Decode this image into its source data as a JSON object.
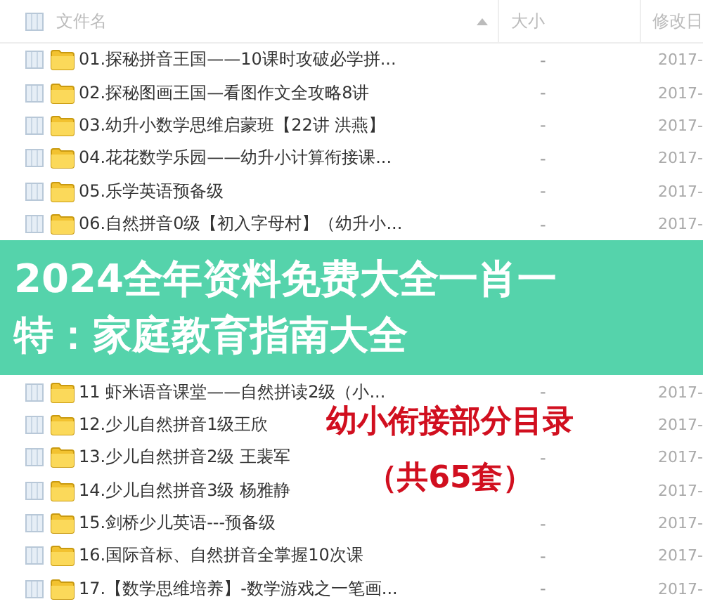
{
  "header": {
    "checked": false,
    "name": "文件名",
    "size": "大小",
    "date": "修改日"
  },
  "rows": [
    {
      "name": "01.探秘拼音王国——10课时攻破必学拼...",
      "size": "-",
      "date": "2017-",
      "checked": false
    },
    {
      "name": "02.探秘图画王国—看图作文全攻略8讲",
      "size": "-",
      "date": "2017-",
      "checked": false
    },
    {
      "name": "03.幼升小数学思维启蒙班【22讲 洪燕】",
      "size": "-",
      "date": "2017-",
      "checked": false
    },
    {
      "name": "04.花花数学乐园——幼升小计算衔接课...",
      "size": "-",
      "date": "2017-",
      "checked": false
    },
    {
      "name": "05.乐学英语预备级",
      "size": "-",
      "date": "2017-",
      "checked": false
    },
    {
      "name": "06.自然拼音0级【初入字母村】（幼升小...",
      "size": "-",
      "date": "2017-",
      "checked": false
    },
    {
      "name": "11 虾米语音课堂——自然拼读2级（小...",
      "size": "-",
      "date": "2017-",
      "checked": false
    },
    {
      "name": "12.少儿自然拼音1级王欣",
      "date": "2017-",
      "checked": false
    },
    {
      "name": "13.少儿自然拼音2级 王裴军",
      "size": "-",
      "date": "2017-",
      "checked": false
    },
    {
      "name": "14.少儿自然拼音3级 杨雅静",
      "date": "2017-",
      "checked": false
    },
    {
      "name": "15.剑桥少儿英语---预备级",
      "size": "-",
      "date": "2017-",
      "checked": false
    },
    {
      "name": "16.国际音标、自然拼音全掌握10次课",
      "size": "-",
      "date": "2017-",
      "checked": false
    },
    {
      "name": "17.【数学思维培养】-数学游戏之一笔画...",
      "size": "-",
      "date": "2017-",
      "checked": false
    }
  ],
  "banner": {
    "lines": [
      "2024全年资料免费大全一肖一",
      "特：家庭教育指南大全"
    ]
  },
  "annotation": {
    "lines": [
      "幼小衔接部分目录",
      "（共65套）"
    ]
  }
}
